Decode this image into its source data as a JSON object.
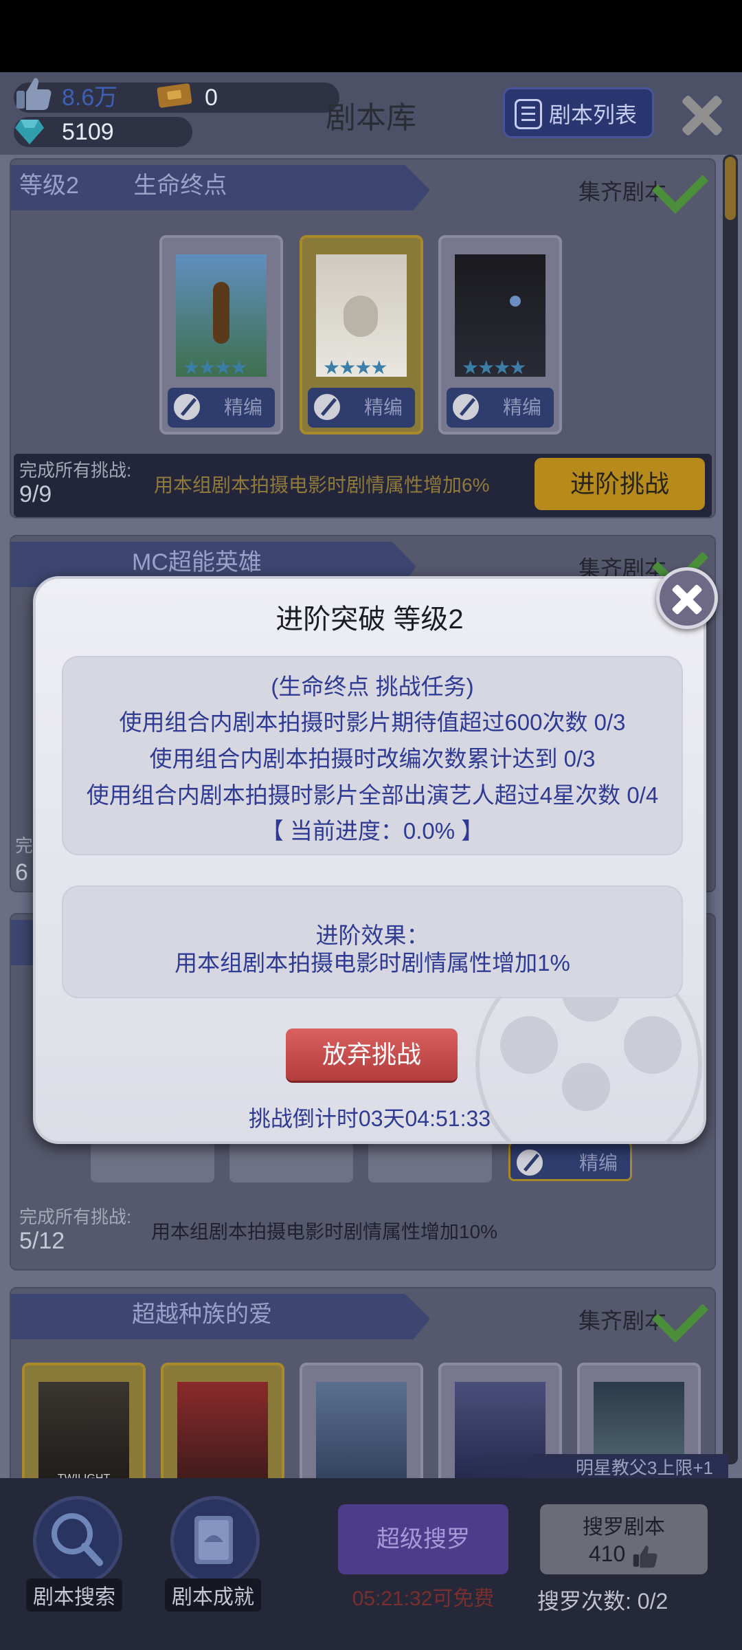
{
  "header": {
    "likes": "8.6万",
    "tickets": "0",
    "diamonds": "5109",
    "title": "剧本库",
    "script_list_label": "剧本列表"
  },
  "groups": [
    {
      "level": "等级2",
      "name": "生命终点",
      "collect_label": "集齐剧本",
      "edit_label": "精编",
      "progress_label": "完成所有挑战:",
      "progress_count": "9/9",
      "effect": "用本组剧本拍摄电影时剧情属性增加6%",
      "advance_label": "进阶挑战"
    },
    {
      "name": "MC超能英雄",
      "collect_label": "集齐剧本",
      "progress_label_partial": "完",
      "progress_count_partial": "6"
    },
    {
      "edit_label": "精编",
      "progress_label": "完成所有挑战:",
      "progress_count": "5/12",
      "effect": "用本组剧本拍摄电影时剧情属性增加10%"
    },
    {
      "name": "超越种族的爱",
      "collect_label": "集齐剧本",
      "poster_caption": "TWILIGHT"
    }
  ],
  "star_banner": "明星教父3上限+1",
  "bottom": {
    "search_label": "剧本搜索",
    "achievement_label": "剧本成就",
    "super_search_label": "超级搜罗",
    "free_timer": "05:21:32可免费",
    "search_script_label": "搜罗剧本",
    "search_script_cost": "410",
    "search_count": "搜罗次数: 0/2"
  },
  "modal": {
    "title": "进阶突破 等级2",
    "task_header": "(生命终点 挑战任务)",
    "tasks": [
      "使用组合内剧本拍摄时影片期待值超过600次数 0/3",
      "使用组合内剧本拍摄时改编次数累计达到 0/3",
      "使用组合内剧本拍摄时影片全部出演艺人超过4星次数 0/4"
    ],
    "current_progress": "【 当前进度：0.0% 】",
    "effect_title": "进阶效果：",
    "effect_text": "用本组剧本拍摄电影时剧情属性增加1%",
    "abandon_label": "放弃挑战",
    "countdown": "挑战倒计时03天04:51:33"
  },
  "colors": {
    "accent_blue": "#2f3b93",
    "abandon_red": "#c94a4a",
    "advance_gold": "#b68a1b",
    "super_purple": "#4d3c8a"
  }
}
